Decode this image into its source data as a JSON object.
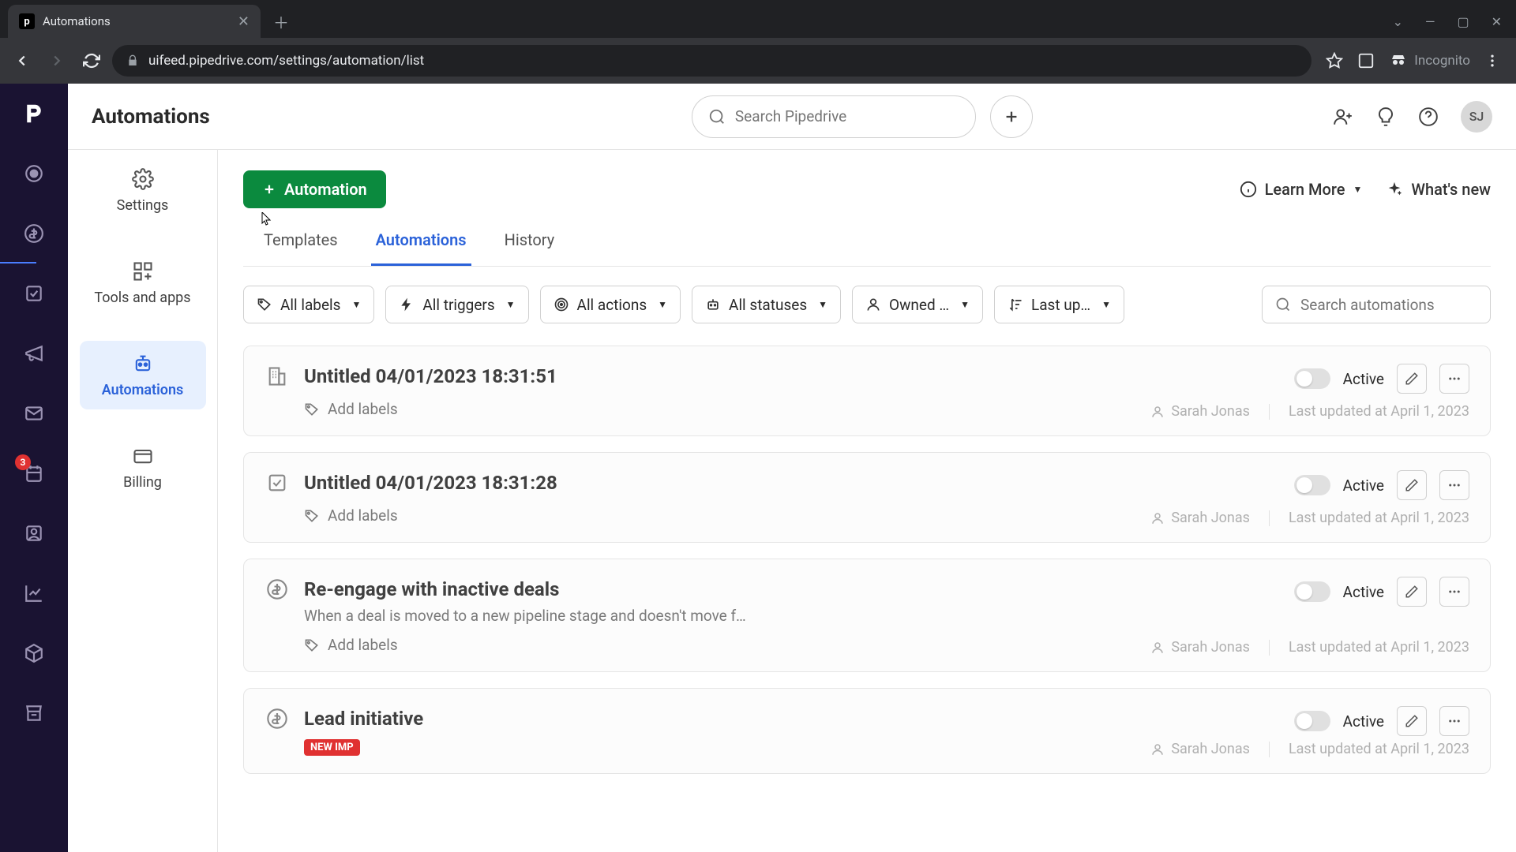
{
  "browser": {
    "tab_title": "Automations",
    "url": "uifeed.pipedrive.com/settings/automation/list",
    "incognito_label": "Incognito"
  },
  "rail": {
    "badge": "3"
  },
  "sidebar": {
    "items": [
      {
        "label": "Settings"
      },
      {
        "label": "Tools and apps"
      },
      {
        "label": "Automations"
      },
      {
        "label": "Billing"
      }
    ]
  },
  "header": {
    "page_title": "Automations",
    "search_placeholder": "Search Pipedrive",
    "avatar": "SJ"
  },
  "actions": {
    "new_button": "Automation",
    "learn_more": "Learn More",
    "whats_new": "What's new"
  },
  "tabs": [
    "Templates",
    "Automations",
    "History"
  ],
  "filters": {
    "labels": "All labels",
    "triggers": "All triggers",
    "actions": "All actions",
    "statuses": "All statuses",
    "owned": "Owned …",
    "sort": "Last up…",
    "search_placeholder": "Search automations"
  },
  "list": [
    {
      "title": "Untitled 04/01/2023 18:31:51",
      "desc": "",
      "icon": "building",
      "add_labels": "Add labels",
      "status": "Active",
      "owner": "Sarah Jonas",
      "updated": "Last updated at April 1, 2023"
    },
    {
      "title": "Untitled 04/01/2023 18:31:28",
      "desc": "",
      "icon": "check",
      "add_labels": "Add labels",
      "status": "Active",
      "owner": "Sarah Jonas",
      "updated": "Last updated at April 1, 2023"
    },
    {
      "title": "Re-engage with inactive deals",
      "desc": "When a deal is moved to a new pipeline stage and doesn't move f…",
      "icon": "dollar",
      "add_labels": "Add labels",
      "status": "Active",
      "owner": "Sarah Jonas",
      "updated": "Last updated at April 1, 2023"
    },
    {
      "title": "Lead initiative",
      "desc": "",
      "icon": "dollar",
      "badge": "NEW IMP",
      "status": "Active",
      "owner": "Sarah Jonas",
      "updated": "Last updated at April 1, 2023"
    }
  ]
}
